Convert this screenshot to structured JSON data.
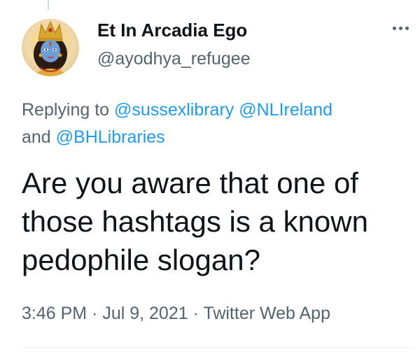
{
  "tweet": {
    "author_name": "Et In Arcadia Ego",
    "author_handle": "@ayodhya_refugee",
    "reply_prefix": "Replying to ",
    "mentions": [
      "@sussexlibrary",
      "@NLIreland",
      "@BHLibraries"
    ],
    "reply_and": "and ",
    "text_lines": [
      "Are you aware that one of",
      "those hashtags is a known",
      "pedophile slogan?"
    ],
    "time": "3:46 PM",
    "separator": " · ",
    "date": "Jul 9, 2021",
    "source": "Twitter Web App",
    "more_icon": "more-horizontal-icon"
  },
  "colors": {
    "link": "#1d9bf0",
    "secondary_text": "#536471",
    "primary_text": "#0f1419",
    "divider": "#eff3f4"
  }
}
